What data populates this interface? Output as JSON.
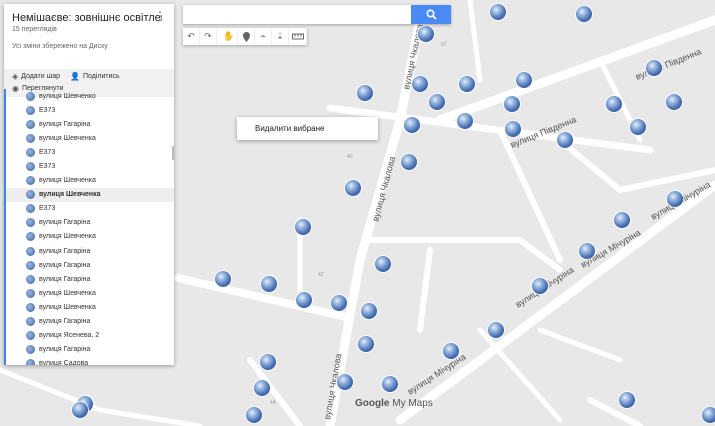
{
  "sidebar": {
    "title": "Немішаєве: зовнішнє освітленн…",
    "views": "15 переглядів",
    "saved_status": "Усі зміни збережено на Диску",
    "add_layer": "Додати шар",
    "share": "Поділитись",
    "preview": "Переглянути",
    "items": [
      {
        "label": "вулиця Шевченко"
      },
      {
        "label": "E373"
      },
      {
        "label": "вулиця Гагаріна"
      },
      {
        "label": "вулиця Шевченка"
      },
      {
        "label": "E373"
      },
      {
        "label": "E373"
      },
      {
        "label": "вулиця Шевченка"
      },
      {
        "label": "вулиця Шевченка",
        "selected": true
      },
      {
        "label": "E373"
      },
      {
        "label": "вулиця Гагаріна"
      },
      {
        "label": "вулиця Шевченка"
      },
      {
        "label": "вулиця Гагаріна"
      },
      {
        "label": "вулиця Гагаріна"
      },
      {
        "label": "вулиця Гагаріна"
      },
      {
        "label": "вулиця Шевченка"
      },
      {
        "label": "вулиця Шевченка"
      },
      {
        "label": "вулиця Гагаріна"
      },
      {
        "label": "вулиця Ясенева, 2"
      },
      {
        "label": "вулиця Гагаріна"
      },
      {
        "label": "вулиця Садова"
      }
    ]
  },
  "search": {
    "placeholder": "",
    "value": ""
  },
  "toolbar": {
    "icons": [
      "undo-icon",
      "redo-icon",
      "hand-icon",
      "marker-icon",
      "polygon-icon",
      "route-icon",
      "ruler-icon"
    ]
  },
  "context_menu": {
    "item": "Видалити вибране"
  },
  "map": {
    "streets": {
      "chkalova_1": "вулиця Чкалова",
      "chkalova_2": "вулиця Чкалова",
      "chkalova_3": "вулиця Чкалова",
      "pivdenna_1": "вулиця Південна",
      "pivdenna_2": "вулиця Південна",
      "michurina_1": "вулиця Мічуріна",
      "michurina_2": "вулиця Мічуріна",
      "michurina_3": "вулиця Мічуріна",
      "michurina_4": "вулиця Мічуріна"
    },
    "house_numbers": [
      "67",
      "40",
      "42",
      "44"
    ],
    "attribution": "Google My Maps",
    "logo_google": "Google",
    "logo_mymaps": "My Maps",
    "marker_color": "#3a5e9a",
    "accent": "#4a8af4"
  }
}
